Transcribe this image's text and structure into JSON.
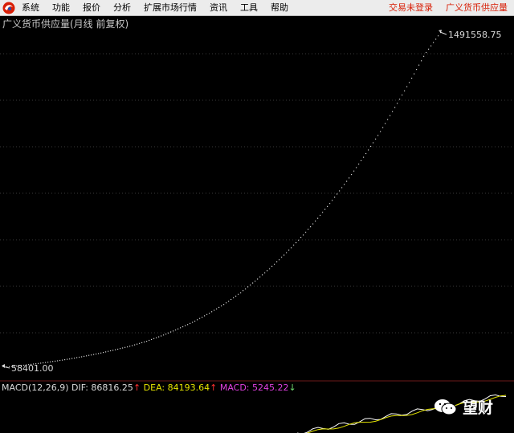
{
  "menu": {
    "items": [
      "系统",
      "功能",
      "报价",
      "分析",
      "扩展市场行情",
      "资讯",
      "工具",
      "帮助"
    ],
    "right_links": [
      "交易未登录",
      "广义货币供应量"
    ]
  },
  "chart": {
    "title": "广义货币供应量(月线 前复权)",
    "max_label": "1491558.75",
    "min_label": "58401.00",
    "macd": {
      "name": "MACD(12,26,9)",
      "dif_label": "DIF: 86816.25",
      "dea_label": "DEA: 84193.64",
      "macd_label": "MACD: 5245.22",
      "dif_arrow": "↑",
      "dea_arrow": "↑",
      "macd_arrow": "↓"
    }
  },
  "watermark": {
    "text": "望财"
  },
  "colors": {
    "background": "#000000",
    "price_dots": "#d0d0d0",
    "grid": "#3a3a3a",
    "dif_line": "#ffffff",
    "dea_line": "#e6e600",
    "menu_red": "#d81e06"
  },
  "chart_data": {
    "type": "line",
    "series": [
      {
        "values": [
          58401,
          65000,
          73000,
          82000,
          92000,
          104000,
          117000,
          132000,
          148000,
          168000,
          192000,
          220000,
          250000,
          286000,
          326000,
          372000,
          425000,
          482000,
          545000,
          614000,
          690000,
          772000,
          860000,
          955000,
          1055000,
          1165000,
          1280000,
          1400000,
          1491558.75
        ]
      }
    ],
    "max_value": 1491558.75,
    "min_value": 58401.0
  }
}
